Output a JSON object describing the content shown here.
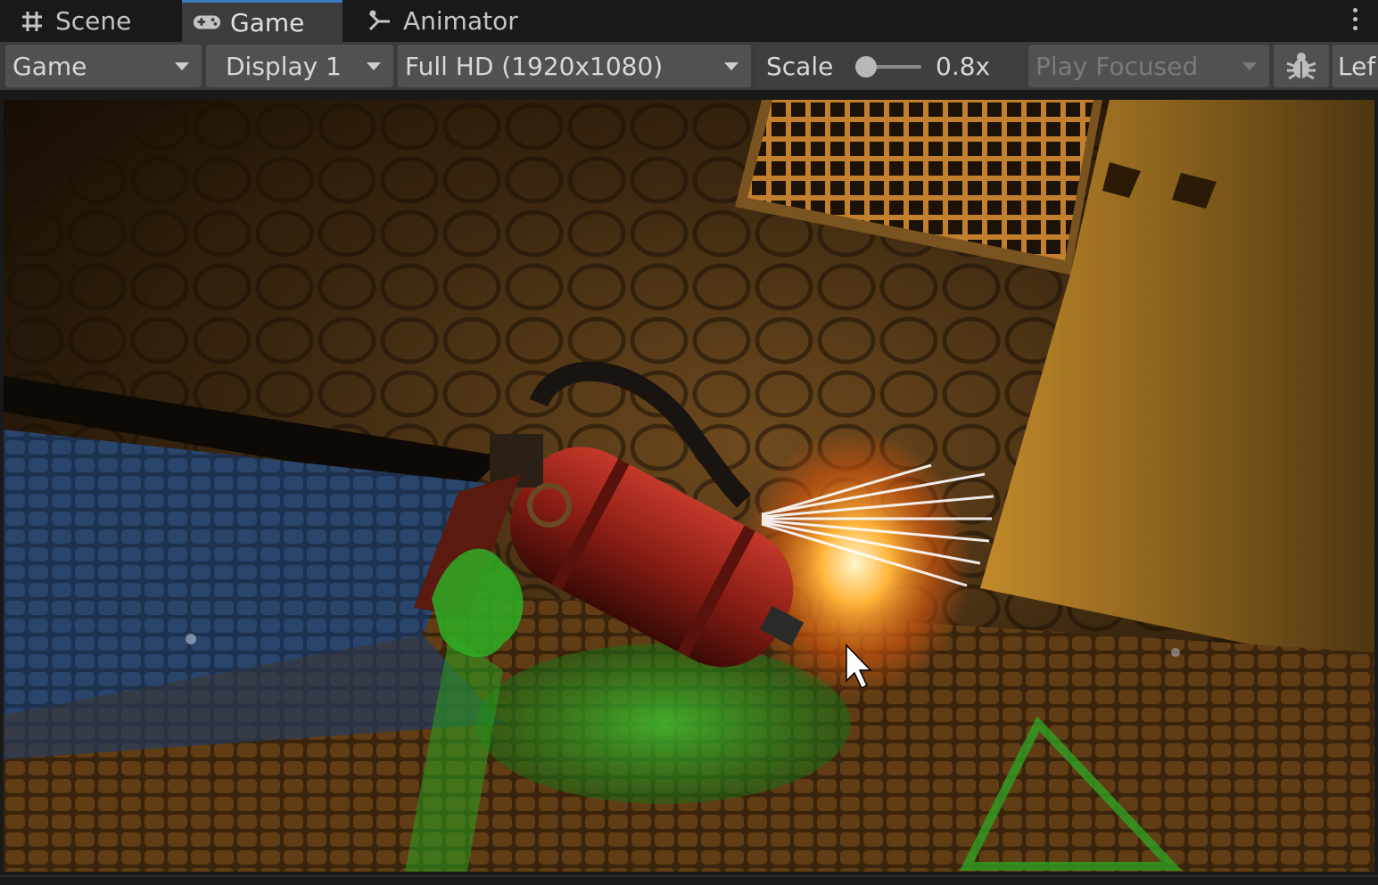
{
  "tabs": [
    {
      "label": "Scene",
      "icon": "grid-hash-icon"
    },
    {
      "label": "Game",
      "icon": "gamepad-icon",
      "active": true
    },
    {
      "label": "Animator",
      "icon": "animator-state-icon"
    }
  ],
  "toolbar": {
    "view_mode": "Game",
    "display": "Display 1",
    "resolution": "Full HD (1920x1080)",
    "scale_label": "Scale",
    "scale_value": "0.8x",
    "play_mode": "Play Focused",
    "stats_icon": "bug-icon",
    "layout_label": "Lef"
  },
  "colors": {
    "accent": "#3a79bb",
    "panel": "#3c3c3c",
    "tabbar": "#191919",
    "dropdown": "#515151"
  }
}
